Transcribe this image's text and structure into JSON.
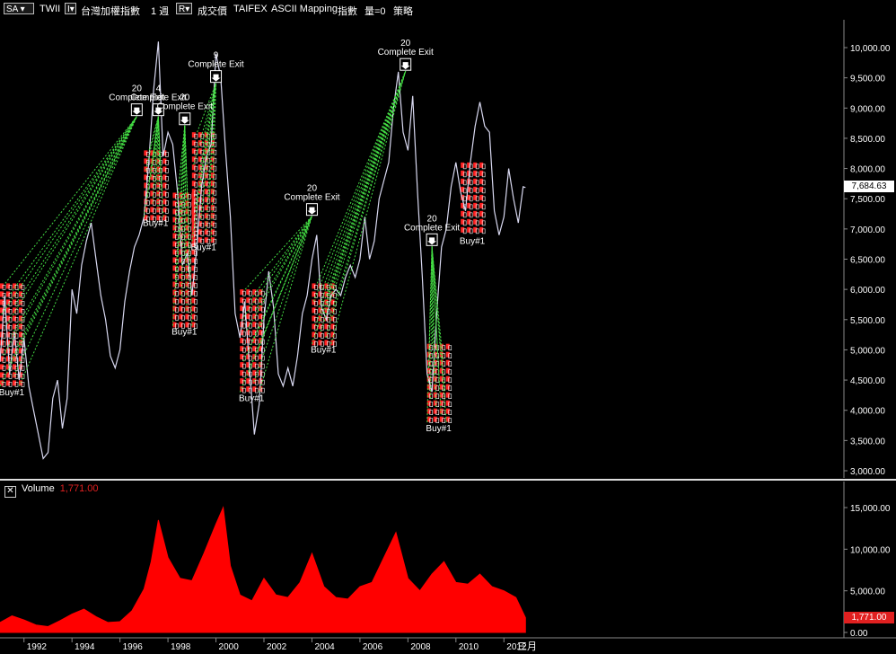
{
  "toolbar": {
    "symbol_button": "SA",
    "symbol": "TWII",
    "name": "台灣加權指數",
    "interval": "1 週",
    "price_field": "成交價",
    "exchange": "TAIFEX",
    "data_source": "ASCII Mapping",
    "index_label": "指數",
    "volume_label": "量=0",
    "strategy_label": "策略"
  },
  "volume_header": {
    "label": "Volume",
    "value": "1,771.00"
  },
  "last_price_tag": "7,684.63",
  "last_volume_tag": "1,771.00",
  "current_month": "三月",
  "colors": {
    "price": "#d8d8f0",
    "volume": "#ff0000",
    "entry_line": "#44dd44",
    "signal": "#ff2020"
  },
  "chart_data": [
    {
      "type": "line",
      "panel": "price",
      "y_ticks": [
        "10,000.00",
        "9,500.00",
        "9,000.00",
        "8,500.00",
        "8,000.00",
        "7,500.00",
        "7,000.00",
        "6,500.00",
        "6,000.00",
        "5,500.00",
        "5,000.00",
        "4,500.00",
        "4,000.00",
        "3,500.00",
        "3,000.00"
      ],
      "ylim": [
        3000,
        10500
      ],
      "x_ticks": [
        "1992",
        "1994",
        "1996",
        "1998",
        "2000",
        "2002",
        "2004",
        "2006",
        "2008",
        "2010",
        "2012"
      ],
      "series": [
        {
          "values": [
            [
              1991.0,
              4800
            ],
            [
              1991.2,
              5900
            ],
            [
              1991.4,
              4600
            ],
            [
              1991.6,
              5300
            ],
            [
              1991.8,
              4500
            ],
            [
              1992.0,
              5200
            ],
            [
              1992.2,
              4400
            ],
            [
              1992.4,
              4000
            ],
            [
              1992.6,
              3600
            ],
            [
              1992.8,
              3200
            ],
            [
              1993.0,
              3300
            ],
            [
              1993.2,
              4200
            ],
            [
              1993.4,
              4500
            ],
            [
              1993.6,
              3700
            ],
            [
              1993.8,
              4200
            ],
            [
              1994.0,
              6000
            ],
            [
              1994.2,
              5600
            ],
            [
              1994.4,
              6400
            ],
            [
              1994.6,
              6800
            ],
            [
              1994.8,
              7100
            ],
            [
              1995.0,
              6500
            ],
            [
              1995.2,
              5900
            ],
            [
              1995.4,
              5500
            ],
            [
              1995.6,
              4900
            ],
            [
              1995.8,
              4700
            ],
            [
              1996.0,
              5000
            ],
            [
              1996.2,
              5800
            ],
            [
              1996.4,
              6300
            ],
            [
              1996.6,
              6700
            ],
            [
              1996.8,
              6900
            ],
            [
              1997.0,
              7200
            ],
            [
              1997.2,
              8100
            ],
            [
              1997.4,
              9300
            ],
            [
              1997.6,
              10100
            ],
            [
              1997.8,
              8200
            ],
            [
              1998.0,
              8600
            ],
            [
              1998.2,
              8400
            ],
            [
              1998.4,
              7600
            ],
            [
              1998.6,
              6400
            ],
            [
              1998.8,
              6600
            ],
            [
              1999.0,
              5900
            ],
            [
              1999.2,
              6700
            ],
            [
              1999.4,
              7700
            ],
            [
              1999.6,
              8200
            ],
            [
              1999.8,
              8400
            ],
            [
              2000.0,
              9900
            ],
            [
              2000.2,
              9500
            ],
            [
              2000.4,
              8300
            ],
            [
              2000.6,
              7200
            ],
            [
              2000.8,
              5600
            ],
            [
              2001.0,
              5200
            ],
            [
              2001.2,
              5800
            ],
            [
              2001.4,
              4700
            ],
            [
              2001.6,
              3600
            ],
            [
              2001.8,
              4100
            ],
            [
              2002.0,
              5500
            ],
            [
              2002.2,
              6300
            ],
            [
              2002.4,
              5700
            ],
            [
              2002.6,
              4600
            ],
            [
              2002.8,
              4400
            ],
            [
              2003.0,
              4700
            ],
            [
              2003.2,
              4400
            ],
            [
              2003.4,
              4900
            ],
            [
              2003.6,
              5600
            ],
            [
              2003.8,
              5900
            ],
            [
              2004.0,
              6500
            ],
            [
              2004.2,
              6900
            ],
            [
              2004.4,
              5700
            ],
            [
              2004.6,
              5500
            ],
            [
              2004.8,
              5900
            ],
            [
              2005.0,
              6000
            ],
            [
              2005.2,
              5900
            ],
            [
              2005.4,
              6200
            ],
            [
              2005.6,
              6400
            ],
            [
              2005.8,
              6200
            ],
            [
              2006.0,
              6500
            ],
            [
              2006.2,
              7200
            ],
            [
              2006.4,
              6500
            ],
            [
              2006.6,
              6800
            ],
            [
              2006.8,
              7500
            ],
            [
              2007.0,
              7800
            ],
            [
              2007.2,
              8100
            ],
            [
              2007.4,
              9000
            ],
            [
              2007.6,
              9600
            ],
            [
              2007.8,
              8600
            ],
            [
              2008.0,
              8300
            ],
            [
              2008.2,
              9200
            ],
            [
              2008.4,
              7600
            ],
            [
              2008.6,
              6200
            ],
            [
              2008.8,
              4600
            ],
            [
              2009.0,
              4300
            ],
            [
              2009.2,
              5600
            ],
            [
              2009.4,
              6700
            ],
            [
              2009.6,
              7000
            ],
            [
              2009.8,
              7700
            ],
            [
              2010.0,
              8100
            ],
            [
              2010.2,
              7600
            ],
            [
              2010.4,
              7300
            ],
            [
              2010.6,
              8100
            ],
            [
              2010.8,
              8700
            ],
            [
              2011.0,
              9100
            ],
            [
              2011.2,
              8700
            ],
            [
              2011.4,
              8600
            ],
            [
              2011.6,
              7300
            ],
            [
              2011.8,
              6900
            ],
            [
              2012.0,
              7200
            ],
            [
              2012.2,
              8000
            ],
            [
              2012.4,
              7500
            ],
            [
              2012.6,
              7100
            ],
            [
              2012.8,
              7700
            ],
            [
              2012.9,
              7684.63
            ]
          ]
        }
      ],
      "annotations": [
        {
          "x": 1996.7,
          "y": 8950,
          "count": "20",
          "label": "Complete Exit"
        },
        {
          "x": 1997.6,
          "y": 8950,
          "count": "4",
          "label": "Complete Exit"
        },
        {
          "x": 1998.7,
          "y": 8800,
          "count": "20",
          "label": "Complete Exit"
        },
        {
          "x": 2000.0,
          "y": 9500,
          "count": "9",
          "label": "Complete Exit"
        },
        {
          "x": 2004.0,
          "y": 7300,
          "count": "20",
          "label": "Complete Exit"
        },
        {
          "x": 2007.9,
          "y": 9700,
          "count": "20",
          "label": "Complete Exit"
        },
        {
          "x": 2009.0,
          "y": 6800,
          "count": "20",
          "label": "Complete Exit"
        }
      ],
      "buy_label": "Buy#1",
      "entry_clusters": [
        {
          "x0": 1991.0,
          "x1": 1991.8,
          "y0": 4400,
          "y1": 6100
        },
        {
          "x0": 1997.0,
          "x1": 1997.8,
          "y0": 7200,
          "y1": 8300
        },
        {
          "x0": 1998.2,
          "x1": 1999.0,
          "y0": 5400,
          "y1": 7600
        },
        {
          "x0": 1999.0,
          "x1": 1999.8,
          "y0": 6800,
          "y1": 8600
        },
        {
          "x0": 2001.0,
          "x1": 2001.8,
          "y0": 4300,
          "y1": 6000
        },
        {
          "x0": 2004.0,
          "x1": 2004.8,
          "y0": 5100,
          "y1": 6100
        },
        {
          "x0": 2008.8,
          "x1": 2009.6,
          "y0": 3800,
          "y1": 5100
        },
        {
          "x0": 2010.2,
          "x1": 2011.0,
          "y0": 6900,
          "y1": 8100
        }
      ]
    },
    {
      "type": "area",
      "panel": "volume",
      "y_ticks": [
        "15,000.00",
        "10,000.00",
        "5,000.00",
        "0.00"
      ],
      "ylim": [
        0,
        18000
      ],
      "series": [
        {
          "values": [
            [
              1991.0,
              1200
            ],
            [
              1991.5,
              2000
            ],
            [
              1992.0,
              1500
            ],
            [
              1992.5,
              900
            ],
            [
              1993.0,
              700
            ],
            [
              1993.5,
              1400
            ],
            [
              1994.0,
              2200
            ],
            [
              1994.5,
              2800
            ],
            [
              1995.0,
              1900
            ],
            [
              1995.5,
              1200
            ],
            [
              1996.0,
              1300
            ],
            [
              1996.5,
              2600
            ],
            [
              1997.0,
              5200
            ],
            [
              1997.3,
              8500
            ],
            [
              1997.6,
              13500
            ],
            [
              1998.0,
              9000
            ],
            [
              1998.5,
              6500
            ],
            [
              1999.0,
              6200
            ],
            [
              1999.5,
              9500
            ],
            [
              2000.0,
              13000
            ],
            [
              2000.3,
              15000
            ],
            [
              2000.6,
              8000
            ],
            [
              2001.0,
              4500
            ],
            [
              2001.5,
              3800
            ],
            [
              2002.0,
              6500
            ],
            [
              2002.5,
              4500
            ],
            [
              2003.0,
              4200
            ],
            [
              2003.5,
              6000
            ],
            [
              2004.0,
              9500
            ],
            [
              2004.5,
              5500
            ],
            [
              2005.0,
              4200
            ],
            [
              2005.5,
              4000
            ],
            [
              2006.0,
              5500
            ],
            [
              2006.5,
              6000
            ],
            [
              2007.0,
              9000
            ],
            [
              2007.5,
              12000
            ],
            [
              2008.0,
              6500
            ],
            [
              2008.5,
              5000
            ],
            [
              2009.0,
              7000
            ],
            [
              2009.5,
              8500
            ],
            [
              2010.0,
              6000
            ],
            [
              2010.5,
              5800
            ],
            [
              2011.0,
              7000
            ],
            [
              2011.5,
              5500
            ],
            [
              2012.0,
              5000
            ],
            [
              2012.5,
              4200
            ],
            [
              2012.9,
              1771
            ]
          ]
        }
      ]
    }
  ]
}
